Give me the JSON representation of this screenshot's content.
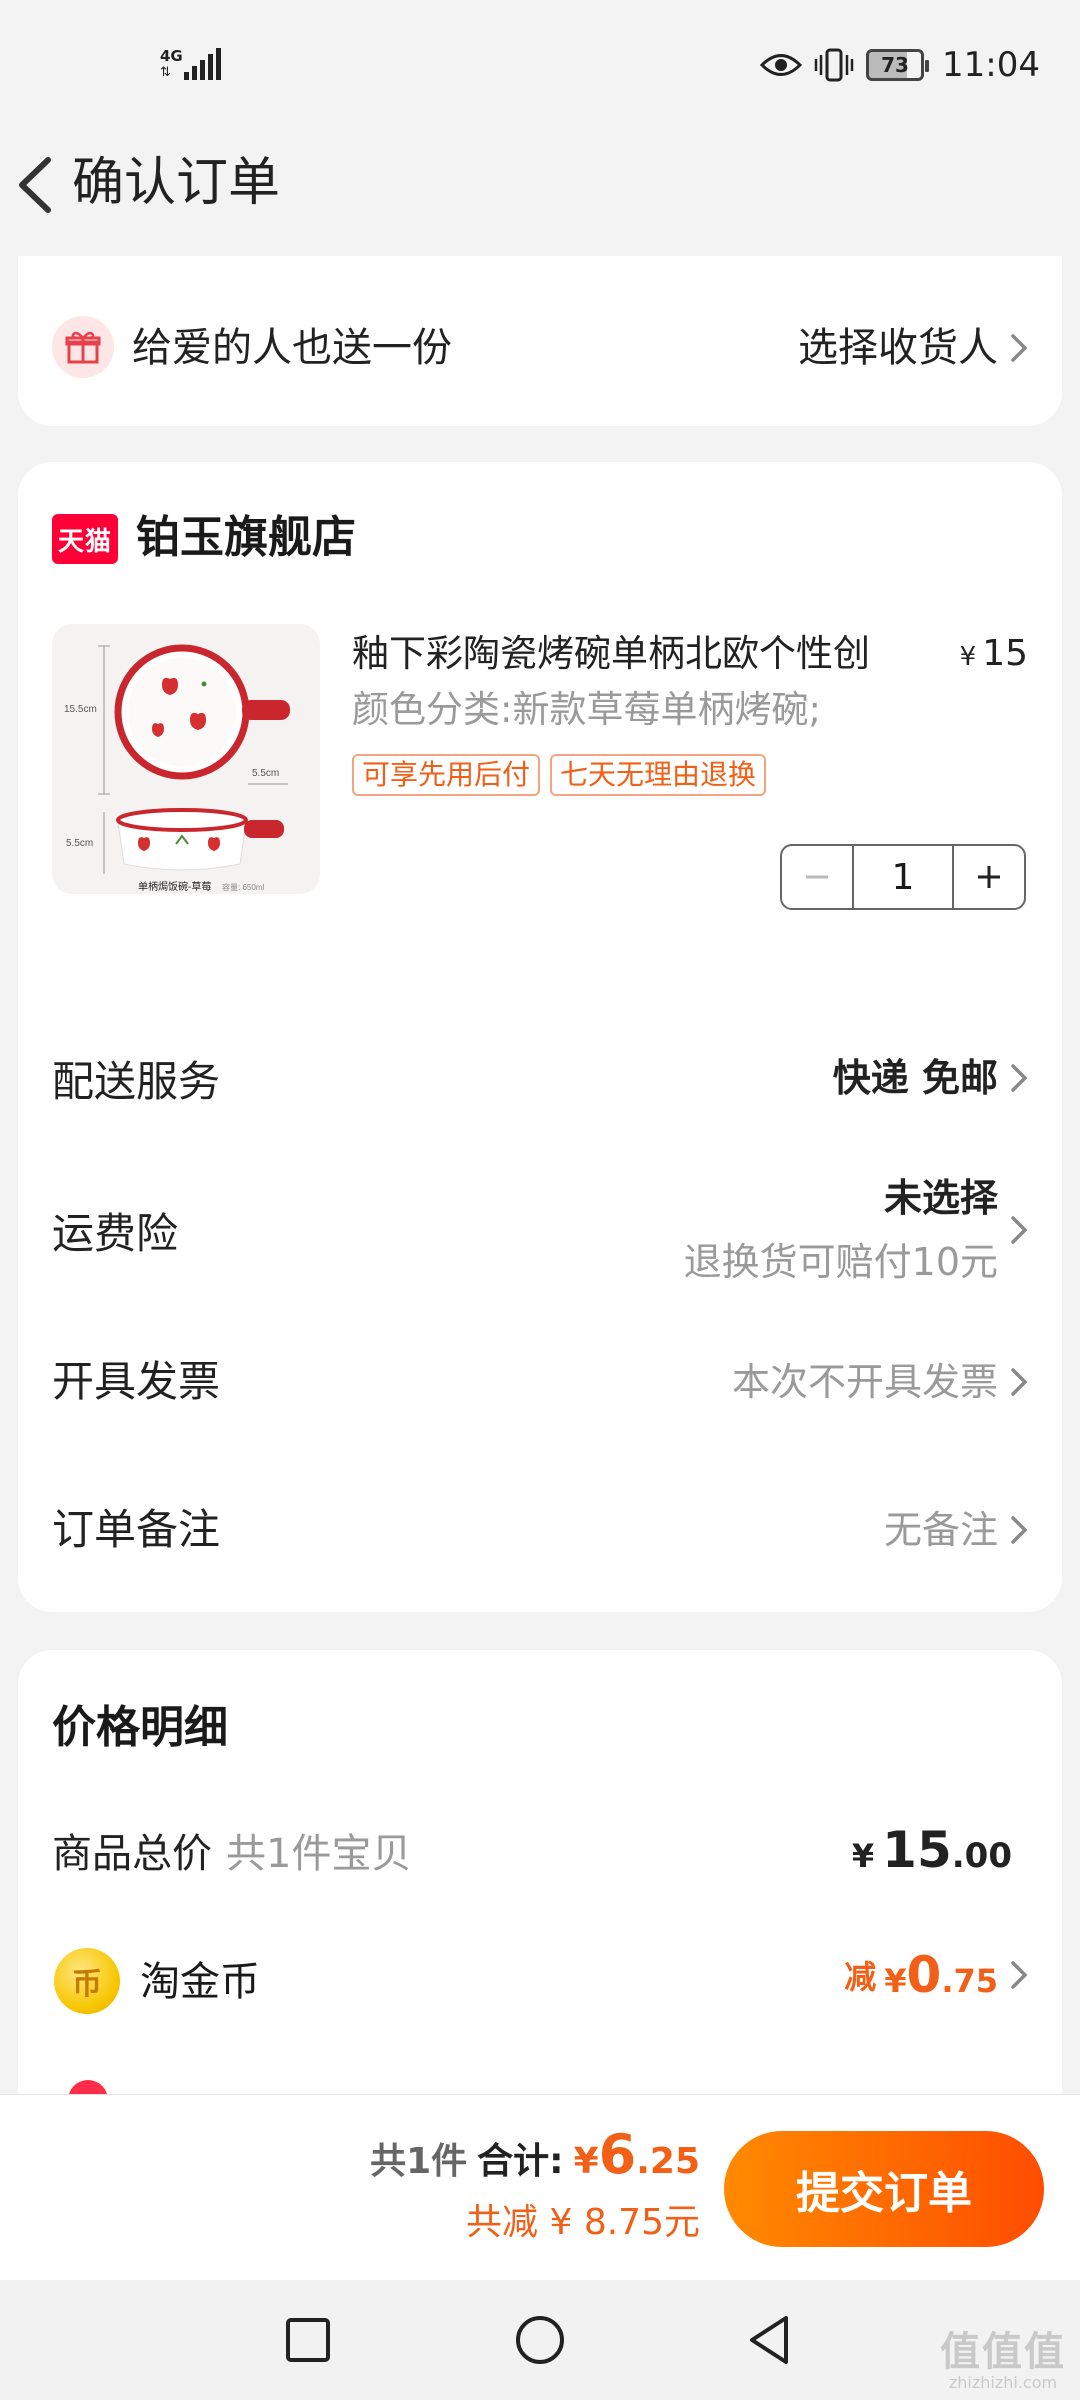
{
  "status_bar": {
    "network_top": "4G",
    "network_bottom": "⇅",
    "battery": "73",
    "time": "11:04"
  },
  "header": {
    "title": "确认订单"
  },
  "gift": {
    "text": "给爱的人也送一份",
    "action": "选择收货人"
  },
  "store": {
    "logo": "天猫",
    "name": "铂玉旗舰店"
  },
  "product": {
    "title": "釉下彩陶瓷烤碗单柄北欧个性创",
    "currency": "¥",
    "price": "15",
    "sku": "颜色分类:新款草莓单柄烤碗;",
    "tags": [
      "可享先用后付",
      "七天无理由退换"
    ],
    "quantity": "1",
    "image_labels": {
      "dim_a": "15.5cm",
      "dim_b": "5.5cm",
      "dim_c": "5.5cm",
      "caption": "单柄焗饭碗-草莓",
      "capacity": "容量: 650ml"
    }
  },
  "services": [
    {
      "label": "配送服务",
      "value": "快递 免邮"
    },
    {
      "label": "运费险",
      "value": "未选择",
      "sub": "退换货可赔付10元"
    },
    {
      "label": "开具发票",
      "value": "本次不开具发票"
    },
    {
      "label": "订单备注",
      "value": "无备注"
    }
  ],
  "price_detail": {
    "title": "价格明细",
    "total_label": "商品总价",
    "total_sub": "共1件宝贝",
    "total_currency": "¥",
    "total_int": "15",
    "total_dec": ".00",
    "coin_label": "淘金币",
    "coin_prefix": "减",
    "coin_currency": "¥",
    "coin_int": "0",
    "coin_dec": ".75"
  },
  "checkout": {
    "count": "共1件",
    "sum_label": "合计:",
    "currency": "¥",
    "sum_int": "6",
    "sum_dec": ".25",
    "saved": "共减 ¥ 8.75元",
    "submit": "提交订单"
  },
  "watermark": {
    "logo": "值值值",
    "url": "zhizhizhi.com"
  },
  "colors": {
    "accent": "#f25f16",
    "tmall": "#ff0036",
    "background": "#f3f3f3"
  }
}
